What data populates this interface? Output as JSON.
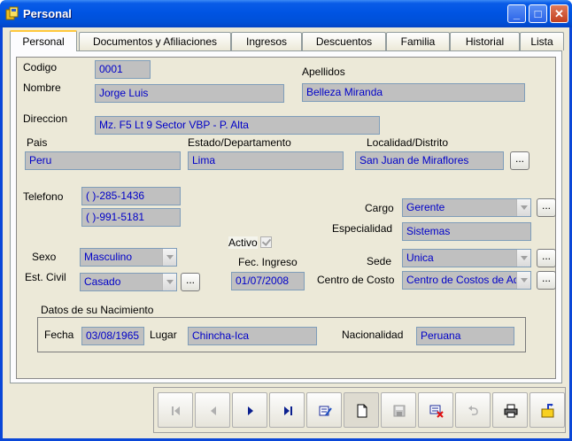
{
  "window": {
    "title": "Personal"
  },
  "tabs": [
    "Personal",
    "Documentos y Afiliaciones",
    "Ingresos",
    "Descuentos",
    "Familia",
    "Historial",
    "Lista"
  ],
  "form": {
    "codigo_label": "Codigo",
    "codigo": "0001",
    "nombre_label": "Nombre",
    "nombre": "Jorge Luis",
    "apellidos_label": "Apellidos",
    "apellidos": "Belleza Miranda",
    "direccion_label": "Direccion",
    "direccion": "Mz. F5 Lt 9 Sector VBP - P. Alta",
    "pais_label": "Pais",
    "pais": "Peru",
    "estado_label": "Estado/Departamento",
    "estado": "Lima",
    "localidad_label": "Localidad/Distrito",
    "localidad": "San Juan de Miraflores",
    "telefono_label": "Telefono",
    "telefono1": "(   )-285-1436",
    "telefono2": "(   )-991-5181",
    "activo_label": "Activo",
    "cargo_label": "Cargo",
    "cargo": "Gerente",
    "especialidad_label": "Especialidad",
    "especialidad": "Sistemas",
    "sexo_label": "Sexo",
    "sexo": "Masculino",
    "fec_ingreso_label": "Fec. Ingreso",
    "fec_ingreso": "01/07/2008",
    "sede_label": "Sede",
    "sede": "Unica",
    "est_civil_label": "Est. Civil",
    "est_civil": "Casado",
    "centro_costo_label": "Centro de Costo",
    "centro_costo": "Centro de Costos de Ad",
    "nacimiento": {
      "group_title": "Datos de su Nacimiento",
      "fecha_label": "Fecha",
      "fecha": "03/08/1965",
      "lugar_label": "Lugar",
      "lugar": "Chincha-Ica",
      "nacionalidad_label": "Nacionalidad",
      "nacionalidad": "Peruana"
    },
    "ellipsis": "..."
  },
  "toolbar": [
    "first-icon",
    "previous-icon",
    "next-icon",
    "last-icon",
    "edit-icon",
    "new-icon",
    "save-icon",
    "delete-icon",
    "undo-icon",
    "print-icon",
    "exit-icon"
  ]
}
